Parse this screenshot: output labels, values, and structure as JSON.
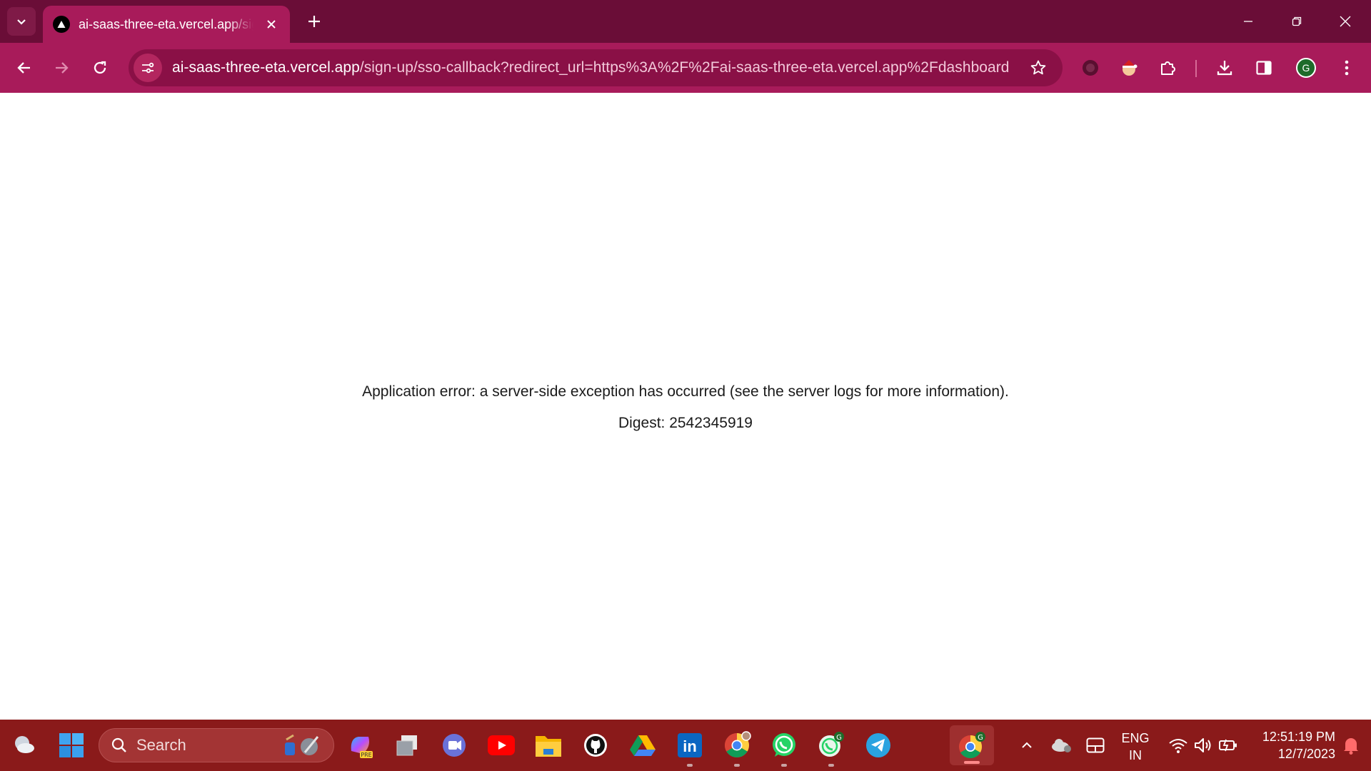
{
  "browser": {
    "tab_title": "ai-saas-three-eta.vercel.app/sig",
    "url_host": "ai-saas-three-eta.vercel.app",
    "url_path": "/sign-up/sso-callback?redirect_url=https%3A%2F%2Fai-saas-three-eta.vercel.app%2Fdashboard",
    "profile_initial": "G",
    "colors": {
      "frame": "#6a0d37",
      "toolbar": "#a81b5a",
      "omnibox": "#8a1046"
    }
  },
  "page": {
    "error_message": "Application error: a server-side exception has occurred (see the server logs for more information).",
    "digest": "Digest: 2542345919"
  },
  "taskbar": {
    "search_label": "Search",
    "language_line1": "ENG",
    "language_line2": "IN",
    "time": "12:51:19 PM",
    "date": "12/7/2023",
    "apps": [
      "weather-icon",
      "windows-start-icon",
      "copilot-icon",
      "task-view-icon",
      "teams-icon",
      "youtube-icon",
      "file-explorer-icon",
      "github-icon",
      "google-drive-icon",
      "linkedin-icon",
      "chrome-icon",
      "whatsapp-icon",
      "whatsapp-beta-icon",
      "telegram-icon",
      "chrome-active-icon"
    ],
    "colors": {
      "background": "#8a1a1a"
    }
  }
}
